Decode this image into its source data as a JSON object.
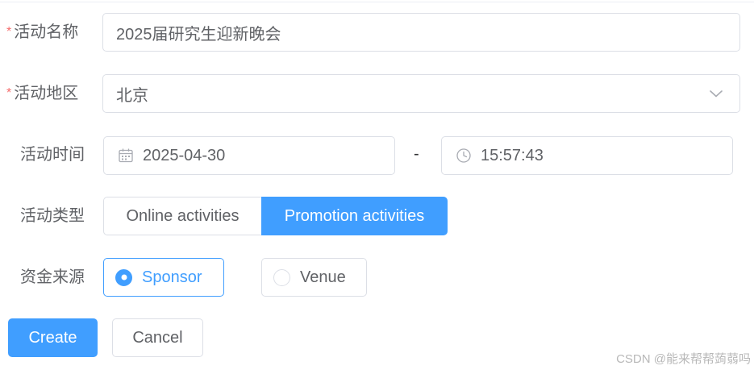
{
  "form": {
    "name": {
      "label": "活动名称",
      "required_mark": "*",
      "value": "2025届研究生迎新晚会"
    },
    "region": {
      "label": "活动地区",
      "required_mark": "*",
      "value": "北京"
    },
    "time": {
      "label": "活动时间",
      "date_value": "2025-04-30",
      "separator": "-",
      "time_value": "15:57:43"
    },
    "type": {
      "label": "活动类型",
      "options": [
        {
          "label": "Online activities",
          "selected": false
        },
        {
          "label": "Promotion activities",
          "selected": true
        }
      ]
    },
    "resource": {
      "label": "资金来源",
      "options": [
        {
          "label": "Sponsor",
          "checked": true
        },
        {
          "label": "Venue",
          "checked": false
        }
      ]
    },
    "actions": {
      "create_label": "Create",
      "cancel_label": "Cancel"
    }
  },
  "watermark": "CSDN @能来帮帮蒟蒻吗",
  "colors": {
    "primary": "#409eff",
    "border": "#dcdfe6",
    "text": "#606266",
    "required": "#f56c6c"
  },
  "icons": {
    "region_select": "chevron-down-icon",
    "date_picker": "calendar-icon",
    "time_picker": "clock-icon"
  }
}
